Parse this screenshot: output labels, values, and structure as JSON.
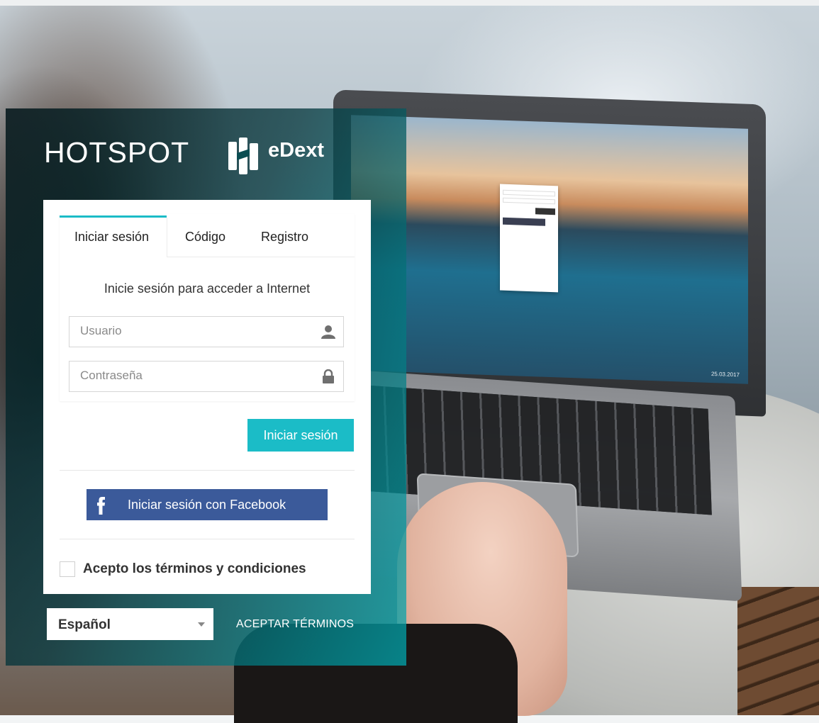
{
  "brand": {
    "hotspot": "HOTSPOT",
    "logo_name": "eDext"
  },
  "login": {
    "tabs": [
      {
        "label": "Iniciar sesión",
        "active": true
      },
      {
        "label": "Código",
        "active": false
      },
      {
        "label": "Registro",
        "active": false
      }
    ],
    "title": "Inicie sesión para acceder a Internet",
    "username_placeholder": "Usuario",
    "password_placeholder": "Contraseña",
    "submit_label": "Iniciar sesión",
    "facebook_label": "Iniciar sesión con Facebook",
    "terms_label": "Acepto los términos y condiciones",
    "terms_checked": false
  },
  "footer": {
    "language": "Español",
    "accept_terms": "ACEPTAR TÉRMINOS"
  },
  "background": {
    "screen_date": "25.03.2017"
  },
  "colors": {
    "accent": "#1bbcc7",
    "facebook": "#3b5a9a",
    "overlay_dark": "#06181c"
  },
  "icons": {
    "username_field": "user-icon",
    "password_field": "lock-icon",
    "facebook": "facebook-icon",
    "language": "chevron-down-icon"
  }
}
